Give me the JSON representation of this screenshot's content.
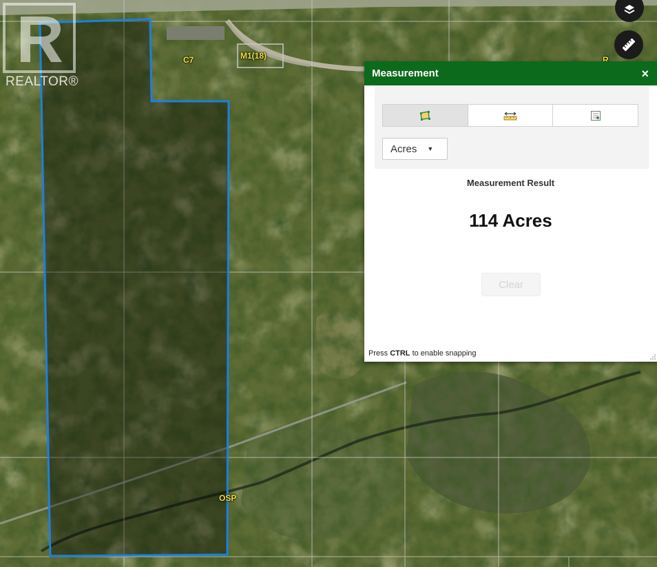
{
  "map": {
    "zone_labels": {
      "c7": "C7",
      "m1": "M1(18)",
      "osp": "OSP",
      "r": "R"
    },
    "boundary_color": "#1e7fe0"
  },
  "logo": {
    "text": "REALTOR®"
  },
  "map_buttons": {
    "layers_icon": "map-layers-icon",
    "measure_icon": "ruler-icon"
  },
  "measurement": {
    "title": "Measurement",
    "close_label": "×",
    "tools": [
      {
        "name": "area",
        "icon": "area-measure-icon",
        "active": true
      },
      {
        "name": "distance",
        "icon": "distance-measure-icon",
        "active": false
      },
      {
        "name": "location",
        "icon": "location-measure-icon",
        "active": false
      }
    ],
    "unit_selected": "Acres",
    "result_label": "Measurement Result",
    "result_value": "114 Acres",
    "clear_label": "Clear",
    "snap_hint_prefix": "Press ",
    "snap_hint_key": "CTRL",
    "snap_hint_suffix": " to enable snapping",
    "header_color": "#0b6a1c"
  }
}
